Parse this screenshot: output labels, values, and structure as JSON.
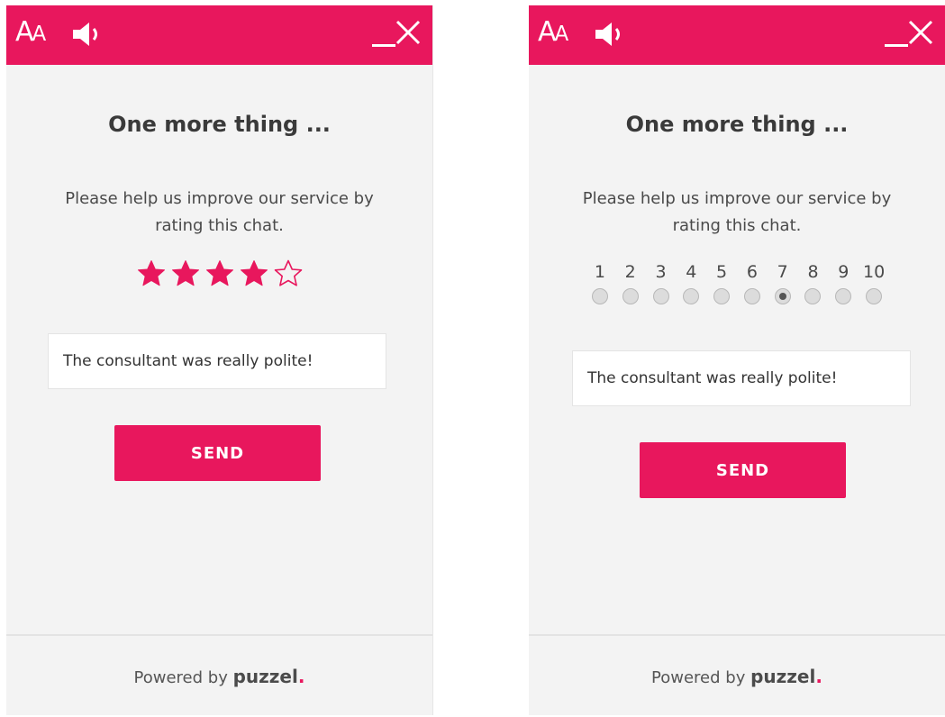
{
  "colors": {
    "accent": "#e8175d",
    "panel_bg": "#f3f3f3",
    "star_fill": "#e8175d"
  },
  "header": {
    "font_icon_big": "A",
    "font_icon_small": "A",
    "icons": [
      "font-size-icon",
      "speaker-icon",
      "minimize-icon",
      "close-icon"
    ]
  },
  "stars_panel": {
    "title": "One more thing ...",
    "subtitle": "Please help us improve our service by rating this chat.",
    "rating": 4,
    "max_rating": 5,
    "comment_value": "The consultant was really polite!",
    "send_label": "SEND",
    "footer_prefix": "Powered by",
    "brand": "puzzel",
    "brand_dot": "."
  },
  "scale_panel": {
    "title": "One more thing ...",
    "subtitle": "Please help us improve our service by rating this chat.",
    "options": [
      "1",
      "2",
      "3",
      "4",
      "5",
      "6",
      "7",
      "8",
      "9",
      "10"
    ],
    "selected": "7",
    "comment_value": "The consultant was really polite!",
    "send_label": "SEND",
    "footer_prefix": "Powered by",
    "brand": "puzzel",
    "brand_dot": "."
  }
}
